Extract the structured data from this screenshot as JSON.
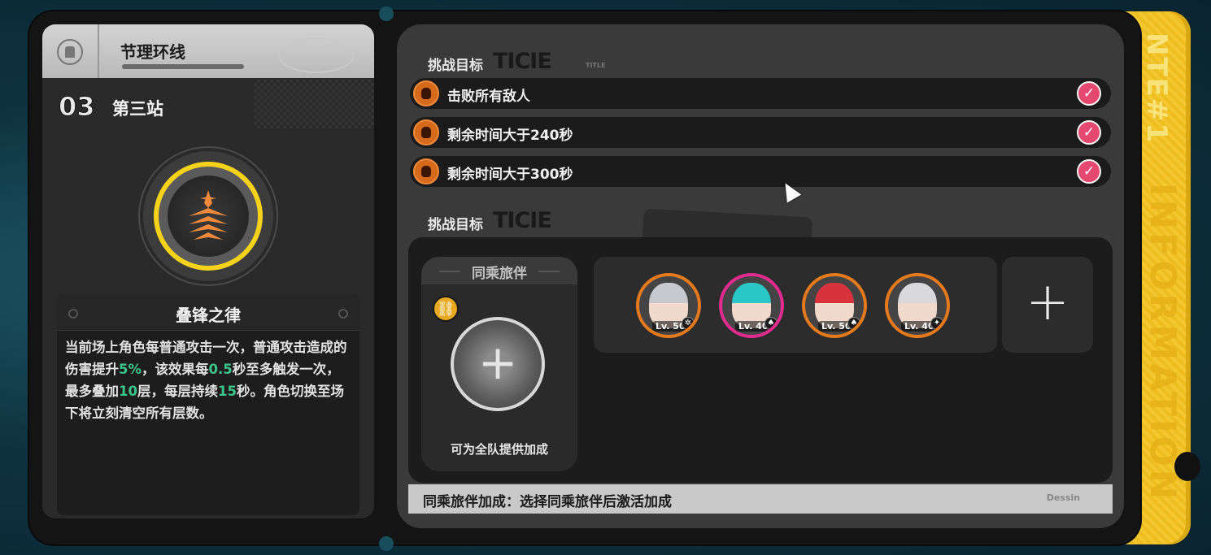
{
  "stage": {
    "series_title": "节理环线",
    "number": "03",
    "name": "第三站"
  },
  "skill": {
    "name": "叠锋之律",
    "description_parts": [
      {
        "text": "当前场上角色每普通攻击一次，普通攻击造成的伤害提升",
        "highlight": false
      },
      {
        "text": "5%",
        "highlight": true
      },
      {
        "text": "，该效果每",
        "highlight": false
      },
      {
        "text": "0.5",
        "highlight": true
      },
      {
        "text": "秒至多触发一次，最多叠加",
        "highlight": false
      },
      {
        "text": "10",
        "highlight": true
      },
      {
        "text": "层，每层持续",
        "highlight": false
      },
      {
        "text": "15",
        "highlight": true
      },
      {
        "text": "秒。角色切换至场下将立刻清空所有层数。",
        "highlight": false
      }
    ]
  },
  "challenge": {
    "section_label": "挑战目标",
    "section_label_2": "挑战目标",
    "deco_text": "TICIE",
    "objectives": [
      {
        "text": "击败所有敌人",
        "completed": true
      },
      {
        "text": "剩余时间大于240秒",
        "completed": true
      },
      {
        "text": "剩余时间大于300秒",
        "completed": true
      }
    ]
  },
  "companion": {
    "title": "同乘旅伴",
    "note": "可为全队提供加成",
    "bonus_label": "同乘旅伴加成：",
    "bonus_text": "选择同乘旅伴后激活加成"
  },
  "team": [
    {
      "level_text": "Lv. 50",
      "border": "#e57a1c",
      "hair": "#c8c8d0",
      "element_icon": "gear-icon",
      "element_glyph": "✲"
    },
    {
      "level_text": "Lv. 40",
      "border": "#e12b8f",
      "hair": "#2bc7c9",
      "element_icon": "leaf-icon",
      "element_glyph": "♠"
    },
    {
      "level_text": "Lv. 50",
      "border": "#e57a1c",
      "hair": "#d8323c",
      "element_icon": "leaf-icon",
      "element_glyph": "♠"
    },
    {
      "level_text": "Lv. 40",
      "border": "#e57a1c",
      "hair": "#d9d9dd",
      "element_icon": "star-icon",
      "element_glyph": "✦"
    }
  ],
  "side_tab": {
    "logo_text": "NTE#1",
    "info_text": "INFORMATION"
  },
  "colors": {
    "accent_yellow": "#f6d21a",
    "check_pink": "#e4486e",
    "highlight_green": "#3cc58a",
    "objective_orange": "#d46a1c"
  }
}
